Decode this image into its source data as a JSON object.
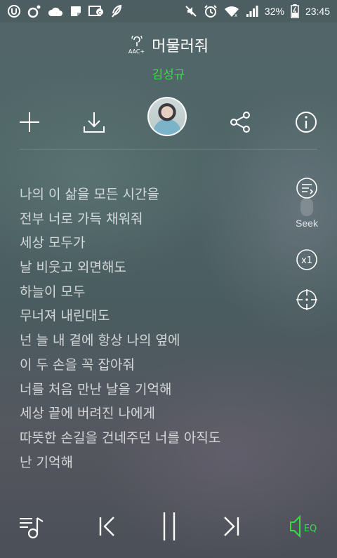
{
  "status_bar": {
    "battery": "32%",
    "time": "23:45"
  },
  "song": {
    "title": "머물러줘",
    "artist": "김성규",
    "format": "AAC+"
  },
  "side_controls": {
    "seek_label": "Seek",
    "speed_label": "x1"
  },
  "lyrics": [
    "나의 이 삶을 모든 시간을",
    "전부 너로 가득 채워줘",
    "세상 모두가",
    "날 비웃고 외면해도",
    "하늘이 모두",
    "무너져 내린대도",
    "넌 늘 내 곁에 항상 나의 옆에",
    "이 두 손을 꼭 잡아줘",
    "너를 처음 만난 날을 기억해",
    "세상 끝에 버려진 나에게",
    "따뜻한 손길을 건네주던 너를 아직도",
    "난 기억해"
  ],
  "eq_label": "EQ",
  "colors": {
    "accent": "#3cd94a"
  }
}
